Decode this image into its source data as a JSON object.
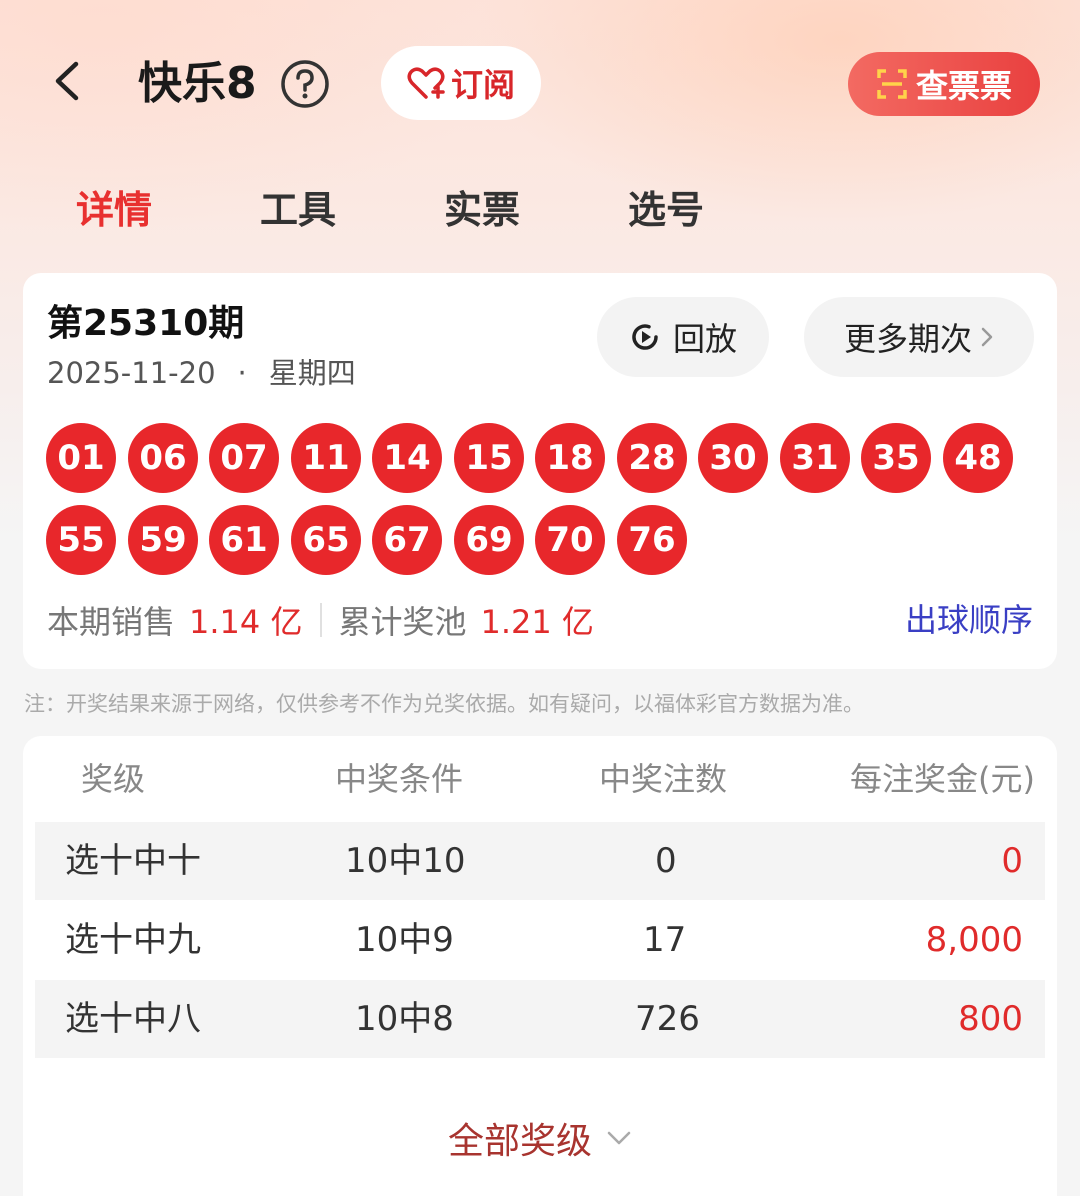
{
  "header": {
    "title": "快乐8",
    "subscribe_label": "订阅",
    "check_ticket_label": "查票票"
  },
  "tabs": [
    {
      "label": "详情",
      "active": true
    },
    {
      "label": "工具",
      "active": false
    },
    {
      "label": "实票",
      "active": false
    },
    {
      "label": "选号",
      "active": false
    }
  ],
  "draw": {
    "issue": "第25310期",
    "date": "2025-11-20",
    "separator": "·",
    "weekday": "星期四",
    "replay_label": "回放",
    "more_label": "更多期次",
    "numbers": [
      "01",
      "06",
      "07",
      "11",
      "14",
      "15",
      "18",
      "28",
      "30",
      "31",
      "35",
      "48",
      "55",
      "59",
      "61",
      "65",
      "67",
      "69",
      "70",
      "76"
    ],
    "sales_label": "本期销售",
    "sales_value": "1.14 亿",
    "pool_label": "累计奖池",
    "pool_value": "1.21 亿",
    "order_link": "出球顺序"
  },
  "note": "注：开奖结果来源于网络，仅供参考不作为兑奖依据。如有疑问，以福体彩官方数据为准。",
  "prize_table": {
    "headers": [
      "奖级",
      "中奖条件",
      "中奖注数",
      "每注奖金(元)"
    ],
    "rows": [
      {
        "level": "选十中十",
        "condition": "10中10",
        "count": "0",
        "amount": "0"
      },
      {
        "level": "选十中九",
        "condition": "10中9",
        "count": "17",
        "amount": "8,000"
      },
      {
        "level": "选十中八",
        "condition": "10中8",
        "count": "726",
        "amount": "800"
      }
    ],
    "all_levels_label": "全部奖级"
  },
  "colors": {
    "accent_red": "#e8272b",
    "link_blue": "#3a3fc4",
    "all_levels_brown": "#a8342f"
  }
}
